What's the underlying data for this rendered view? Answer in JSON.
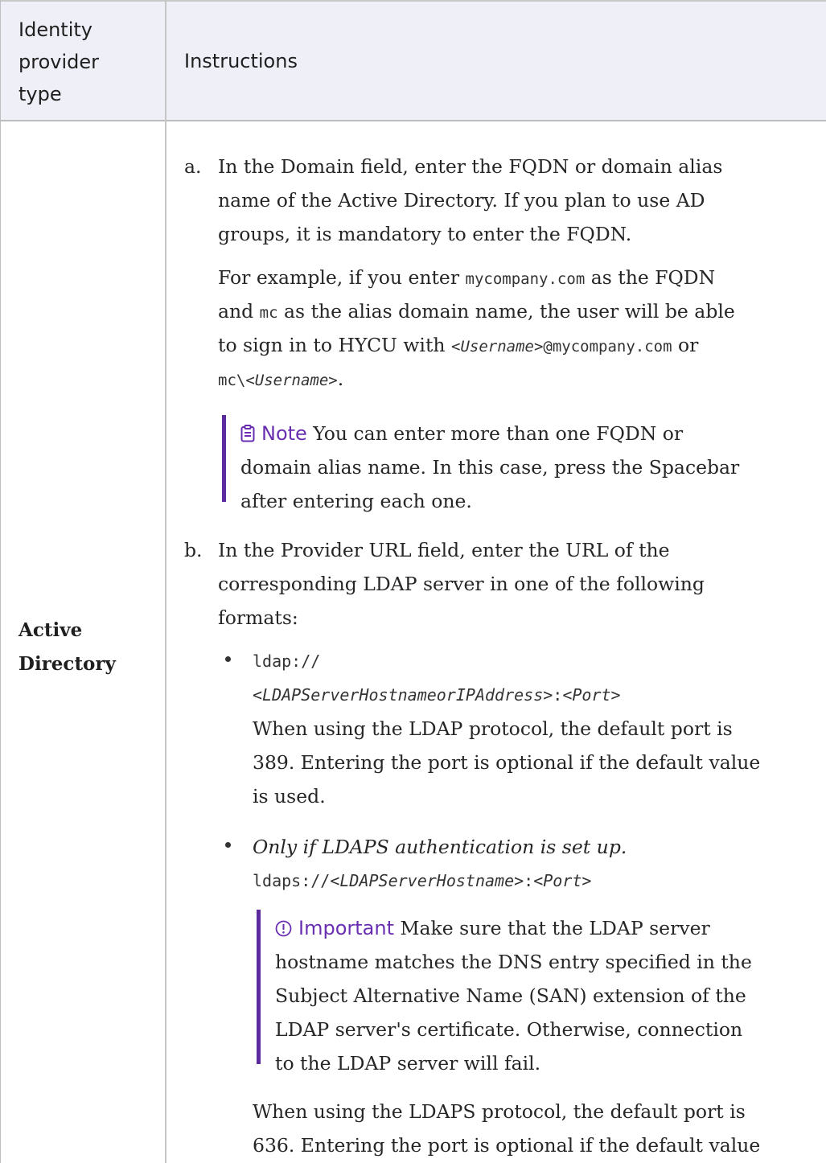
{
  "header": {
    "col1_lines": [
      "Identity",
      "provider",
      "type"
    ],
    "col2": "Instructions"
  },
  "row": {
    "label_lines": [
      "Active",
      "Directory"
    ]
  },
  "step_a": {
    "marker": "a.",
    "lines": [
      "In the Domain field, enter the FQDN or domain alias",
      "name of the Active Directory. If you plan to use AD",
      "groups, it is mandatory to enter the FQDN."
    ],
    "example": {
      "l1_pre": "For example, if you enter ",
      "l1_code": "mycompany.com",
      "l1_post": " as the FQDN",
      "l2_pre": "and ",
      "l2_code": "mc",
      "l2_post": " as the alias domain name, the user will be able",
      "l3_pre": "to sign in to HYCU with ",
      "l3_code1": "<",
      "l3_ital": "Username",
      "l3_code2": ">@mycompany.com",
      "l3_post": " or",
      "l4_code1": "mc\\<",
      "l4_ital": "Username",
      "l4_code2": ">",
      "l4_post": "."
    },
    "note": {
      "icon": "clipboard-icon",
      "title": "Note",
      "l1": "You can enter more than one FQDN or",
      "l2": "domain alias name. In this case, press the Spacebar",
      "l3": "after entering each one."
    }
  },
  "step_b": {
    "marker": "b.",
    "lines": [
      "In the Provider URL field, enter the URL of the",
      "corresponding LDAP server in one of the following",
      "formats:"
    ],
    "bullet1": {
      "code_l1": "ldap://",
      "code_l2_a": "<",
      "code_l2_ital": "LDAPServerHostnameorIPAddress",
      "code_l2_b": ">:<",
      "code_l2_ital2": "Port",
      "code_l2_c": ">",
      "text_lines": [
        "When using the LDAP protocol, the default port is",
        "389. Entering the port is optional if the default value",
        "is used."
      ]
    },
    "bullet2": {
      "ital_line": "Only if LDAPS authentication is set up.",
      "code_a": "ldaps://<",
      "code_ital": "LDAPServerHostname",
      "code_b": ">:<",
      "code_ital2": "Port",
      "code_c": ">",
      "important": {
        "icon": "exclamation-circle-icon",
        "title": "Important",
        "l1": "Make sure that the LDAP server",
        "l2": "hostname matches the DNS entry specified in the",
        "l3": "Subject Alternative Name (SAN) extension of the",
        "l4": "LDAP server's certificate. Otherwise, connection",
        "l5": "to the LDAP server will fail."
      },
      "text_lines": [
        "When using the LDAPS protocol, the default port is",
        "636. Entering the port is optional if the default value"
      ]
    }
  }
}
